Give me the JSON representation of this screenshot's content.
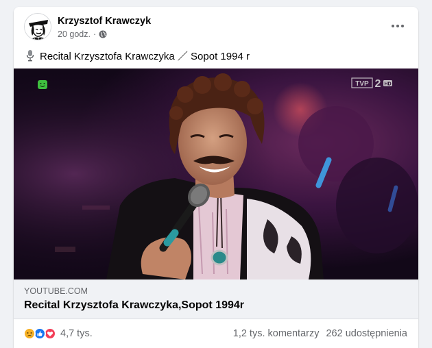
{
  "post": {
    "author": "Krzysztof Krawczyk",
    "time": "20 godz.",
    "separator": "·",
    "text": "Recital Krzysztofa Krawczyka ／ Sopot 1994 r"
  },
  "video": {
    "channel_logo": "TVP2 HD"
  },
  "link": {
    "domain": "YOUTUBE.COM",
    "title": "Recital Krzysztofa Krawczyka,Sopot 1994r"
  },
  "stats": {
    "reactions_count": "4,7 tys.",
    "comments": "1,2 tys. komentarzy",
    "shares": "262 udostępnienia",
    "reaction_icons": [
      "sad-reaction-icon",
      "like-reaction-icon",
      "love-reaction-icon"
    ]
  },
  "colors": {
    "like": "#1877f2",
    "love": "#f33e58",
    "sad": "#f7b125",
    "secondary_text": "#65676b"
  }
}
